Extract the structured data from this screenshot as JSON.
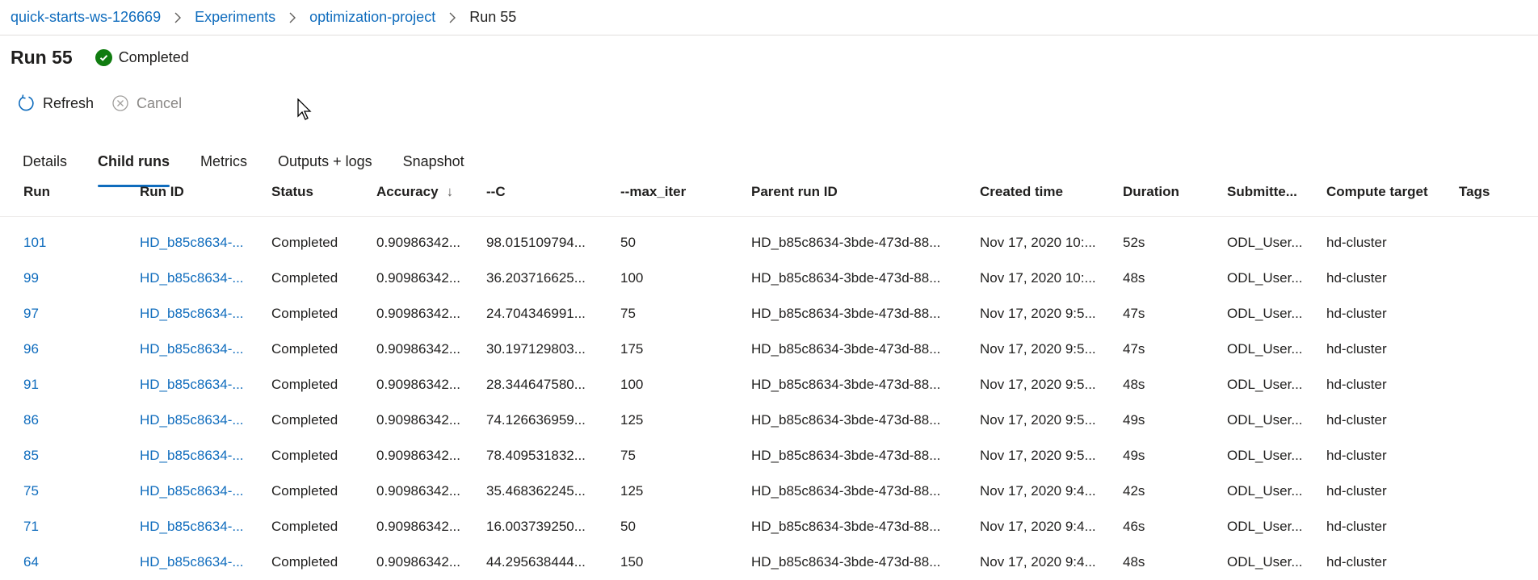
{
  "breadcrumb": {
    "items": [
      "quick-starts-ws-126669",
      "Experiments",
      "optimization-project"
    ],
    "current": "Run 55"
  },
  "header": {
    "title": "Run 55",
    "status": "Completed",
    "status_color": "#107c10"
  },
  "toolbar": {
    "refresh_label": "Refresh",
    "cancel_label": "Cancel"
  },
  "tabs": [
    {
      "label": "Details"
    },
    {
      "label": "Child runs",
      "active": true
    },
    {
      "label": "Metrics"
    },
    {
      "label": "Outputs + logs"
    },
    {
      "label": "Snapshot"
    }
  ],
  "table": {
    "sort_indicator": "↓",
    "columns": [
      "Run",
      "Run ID",
      "Status",
      "Accuracy",
      "--C",
      "--max_iter",
      "Parent run ID",
      "Created time",
      "Duration",
      "Submitte...",
      "Compute target",
      "Tags"
    ],
    "rows": [
      [
        "101",
        "HD_b85c8634-...",
        "Completed",
        "0.90986342...",
        "98.015109794...",
        "50",
        "HD_b85c8634-3bde-473d-88...",
        "Nov 17, 2020 10:...",
        "52s",
        "ODL_User...",
        "hd-cluster",
        ""
      ],
      [
        "99",
        "HD_b85c8634-...",
        "Completed",
        "0.90986342...",
        "36.203716625...",
        "100",
        "HD_b85c8634-3bde-473d-88...",
        "Nov 17, 2020 10:...",
        "48s",
        "ODL_User...",
        "hd-cluster",
        ""
      ],
      [
        "97",
        "HD_b85c8634-...",
        "Completed",
        "0.90986342...",
        "24.704346991...",
        "75",
        "HD_b85c8634-3bde-473d-88...",
        "Nov 17, 2020 9:5...",
        "47s",
        "ODL_User...",
        "hd-cluster",
        ""
      ],
      [
        "96",
        "HD_b85c8634-...",
        "Completed",
        "0.90986342...",
        "30.197129803...",
        "175",
        "HD_b85c8634-3bde-473d-88...",
        "Nov 17, 2020 9:5...",
        "47s",
        "ODL_User...",
        "hd-cluster",
        ""
      ],
      [
        "91",
        "HD_b85c8634-...",
        "Completed",
        "0.90986342...",
        "28.344647580...",
        "100",
        "HD_b85c8634-3bde-473d-88...",
        "Nov 17, 2020 9:5...",
        "48s",
        "ODL_User...",
        "hd-cluster",
        ""
      ],
      [
        "86",
        "HD_b85c8634-...",
        "Completed",
        "0.90986342...",
        "74.126636959...",
        "125",
        "HD_b85c8634-3bde-473d-88...",
        "Nov 17, 2020 9:5...",
        "49s",
        "ODL_User...",
        "hd-cluster",
        ""
      ],
      [
        "85",
        "HD_b85c8634-...",
        "Completed",
        "0.90986342...",
        "78.409531832...",
        "75",
        "HD_b85c8634-3bde-473d-88...",
        "Nov 17, 2020 9:5...",
        "49s",
        "ODL_User...",
        "hd-cluster",
        ""
      ],
      [
        "75",
        "HD_b85c8634-...",
        "Completed",
        "0.90986342...",
        "35.468362245...",
        "125",
        "HD_b85c8634-3bde-473d-88...",
        "Nov 17, 2020 9:4...",
        "42s",
        "ODL_User...",
        "hd-cluster",
        ""
      ],
      [
        "71",
        "HD_b85c8634-...",
        "Completed",
        "0.90986342...",
        "16.003739250...",
        "50",
        "HD_b85c8634-3bde-473d-88...",
        "Nov 17, 2020 9:4...",
        "46s",
        "ODL_User...",
        "hd-cluster",
        ""
      ],
      [
        "64",
        "HD_b85c8634-...",
        "Completed",
        "0.90986342...",
        "44.295638444...",
        "150",
        "HD_b85c8634-3bde-473d-88...",
        "Nov 17, 2020 9:4...",
        "48s",
        "ODL_User...",
        "hd-cluster",
        ""
      ]
    ]
  }
}
